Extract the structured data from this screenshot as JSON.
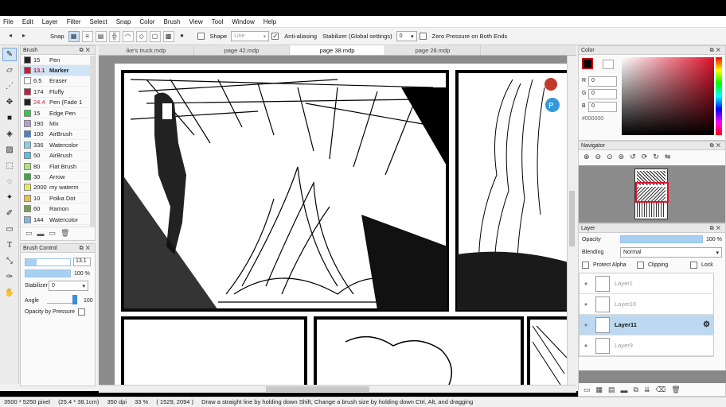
{
  "menu": [
    "File",
    "Edit",
    "Layer",
    "Filter",
    "Select",
    "Snap",
    "Color",
    "Brush",
    "View",
    "Tool",
    "Window",
    "Help"
  ],
  "toolbar": {
    "snap_label": "Snap",
    "shape_label": "Shape",
    "shape_value": "Line",
    "antialias_label": "Anti-aliasing",
    "stabilizer_label": "Stabilizer (Global settings)",
    "stabilizer_value": "0",
    "zero_pressure_label": "Zero Pressure on Both Ends"
  },
  "brush_panel": {
    "title": "Brush",
    "items": [
      {
        "size": "15",
        "name": "Pen",
        "color": "#222222"
      },
      {
        "size": "13.1",
        "name": "Marker",
        "color": "#c41e3a",
        "selected": true
      },
      {
        "size": "6.5",
        "name": "Eraser",
        "color": "#ffffff"
      },
      {
        "size": "174",
        "name": "Fluffy",
        "color": "#c41e3a"
      },
      {
        "size": "24.4",
        "name": "Pen (Fade 1",
        "color": "#222222"
      },
      {
        "size": "15",
        "name": "Edge Pen",
        "color": "#2ecc40"
      },
      {
        "size": "190",
        "name": "Mix",
        "color": "#b39ddb"
      },
      {
        "size": "100",
        "name": "AirBrush",
        "color": "#4a7fd4"
      },
      {
        "size": "336",
        "name": "Watercolor",
        "color": "#7fd4e8"
      },
      {
        "size": "50",
        "name": "AirBrush",
        "color": "#4fc3f7"
      },
      {
        "size": "80",
        "name": "Flat Brush",
        "color": "#aee67a"
      },
      {
        "size": "30",
        "name": "Arrow",
        "color": "#3ea83e"
      },
      {
        "size": "2000",
        "name": "my waterm",
        "color": "#e8e84f"
      },
      {
        "size": "10",
        "name": "Polka Dot",
        "color": "#e8c04f"
      },
      {
        "size": "60",
        "name": "Ramon",
        "color": "#7aa04f"
      },
      {
        "size": "144",
        "name": "Watercolor",
        "color": "#7fb7e8"
      }
    ]
  },
  "brush_control": {
    "title": "Brush Control",
    "size_value": "13.1",
    "opacity_value": "100 %",
    "stabilizer_label": "Stabilizer",
    "stabilizer_value": "0",
    "angle_label": "Angle",
    "angle_value": "100",
    "opacity_pressure_label": "Opacity by Pressure"
  },
  "tabs": [
    "ike's truck.mdp",
    "page 42.mdp",
    "page 38.mdp",
    "page 28.mdp"
  ],
  "active_tab": 2,
  "color_panel": {
    "title": "Color",
    "r_label": "R",
    "r_value": "0",
    "g_label": "G",
    "g_value": "0",
    "b_label": "B",
    "b_value": "0",
    "hex": "#000000",
    "current_color": "#000000",
    "hue_color": "#e0112a"
  },
  "navigator_title": "Navigator",
  "layer_panel": {
    "title": "Layer",
    "opacity_label": "Opacity",
    "opacity_value": "100 %",
    "blending_label": "Blending",
    "blending_value": "Normal",
    "protect_alpha": "Protect Alpha",
    "clipping": "Clipping",
    "lock": "Lock",
    "layers": [
      {
        "name": "Layer1"
      },
      {
        "name": "Layer10"
      },
      {
        "name": "Layer11",
        "active": true
      },
      {
        "name": "Layer9"
      }
    ]
  },
  "status": {
    "dimensions": "3500 * 5250 pixel",
    "physical": "(25.4 * 38.1cm)",
    "dpi": "350 dpi",
    "zoom": "33 %",
    "coords": "( 1529, 2094 )",
    "hint": "Draw a straight line by holding down Shift, Change a brush size by holding down Ctrl, Alt, and dragging"
  }
}
